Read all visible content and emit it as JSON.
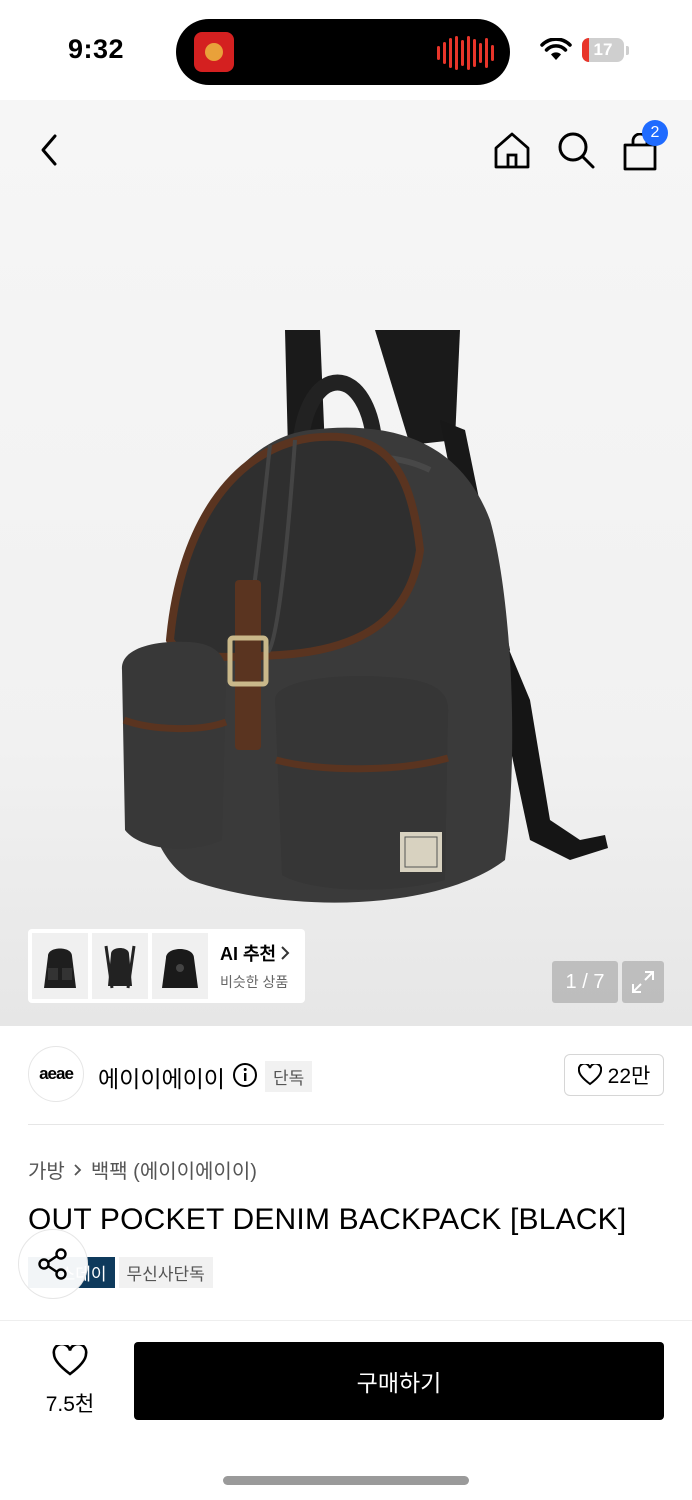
{
  "status_bar": {
    "time": "9:32",
    "battery": "17",
    "battery_level": 0.17
  },
  "nav": {
    "cart_count": "2"
  },
  "gallery": {
    "ai_title": "AI 추천",
    "ai_subtitle": "비슷한 상품",
    "pager": "1 / 7",
    "thumbnails": [
      "front",
      "side",
      "back"
    ]
  },
  "brand": {
    "logo_text": "aeae",
    "name": "에이이에이이",
    "exclusive_tag": "단독",
    "like_count": "22만"
  },
  "product": {
    "breadcrumb": [
      "가방",
      "백팩 (에이이에이이)"
    ],
    "title": "OUT POCKET DENIM BACKPACK [BLACK]",
    "tags": [
      "스데이",
      "무신사단독"
    ]
  },
  "bottom_bar": {
    "wish_count": "7.5천",
    "buy_label": "구매하기"
  },
  "colors": {
    "accent": "#1f6bff",
    "buy_button": "#000000",
    "tag_dark": "#0e3a5c"
  }
}
